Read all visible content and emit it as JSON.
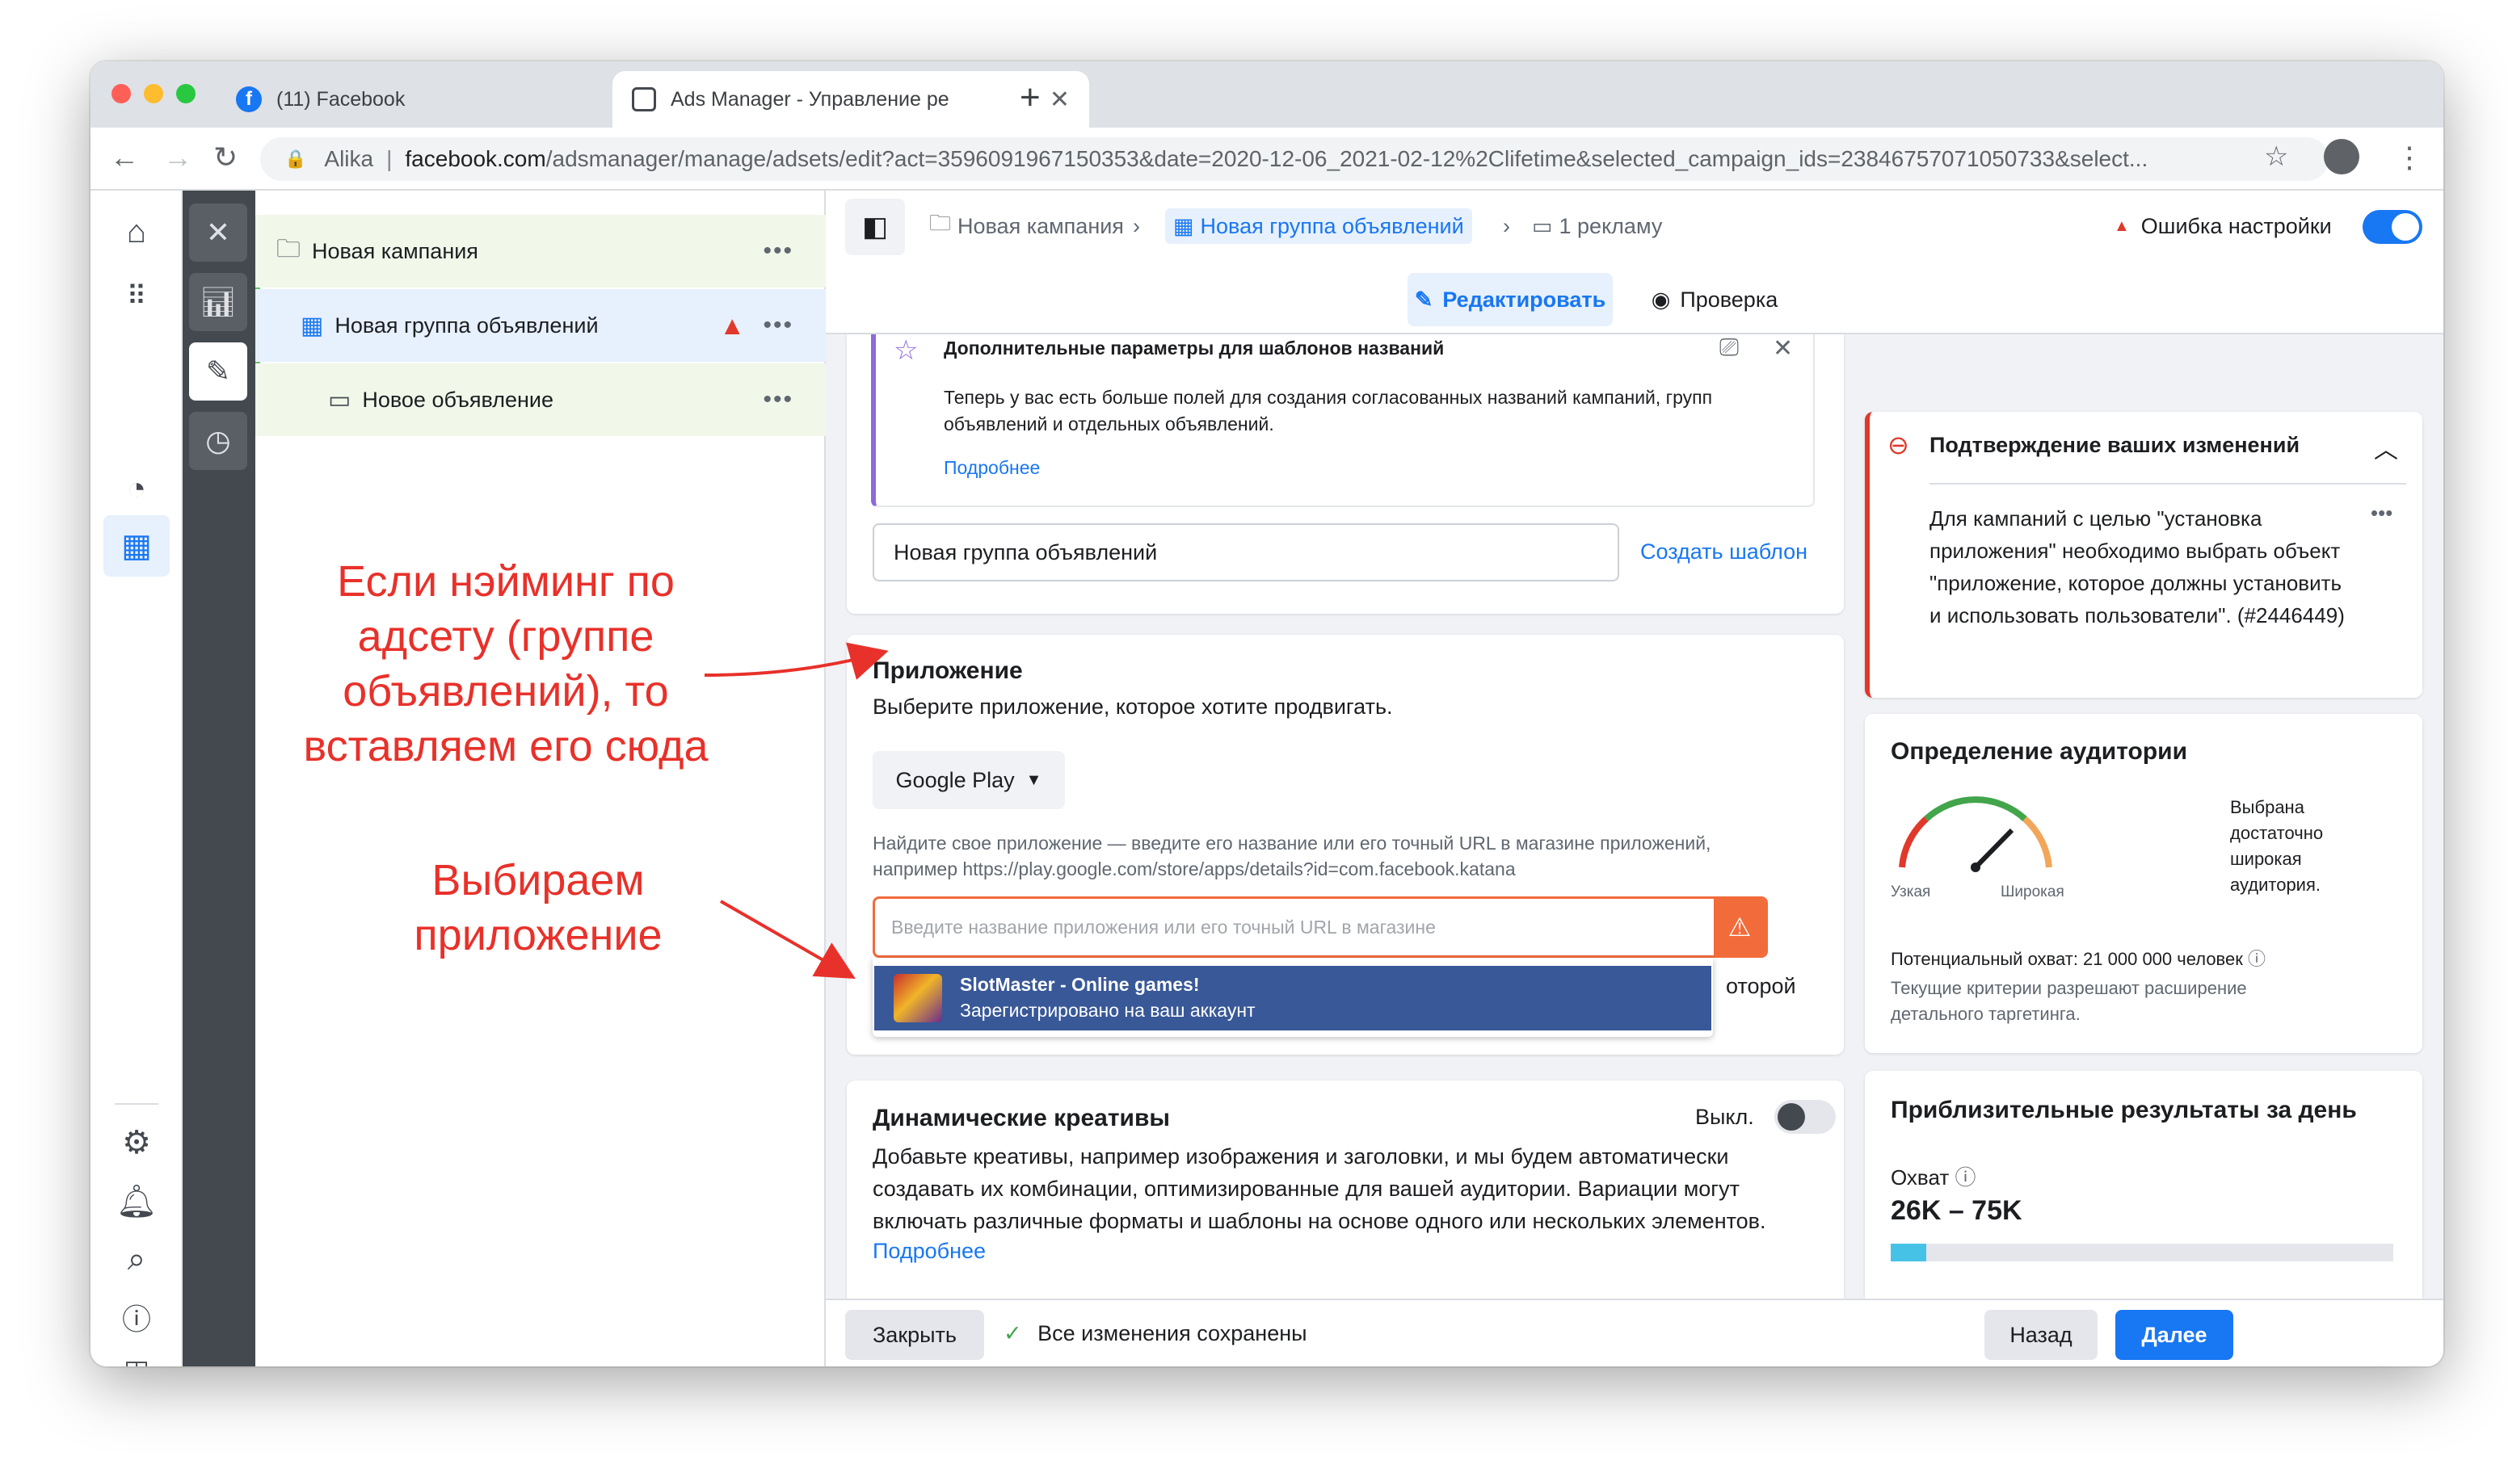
{
  "browser": {
    "tabs": [
      {
        "title": "(11) Facebook",
        "favicon": "facebook-icon"
      },
      {
        "title": "Ads Manager - Управление ре",
        "favicon": "ads-manager-icon"
      }
    ],
    "profile": "Alika",
    "url_host": "facebook.com",
    "url_path": "/adsmanager/manage/adsets/edit?act=3596091967150353&date=2020-12-06_2021-02-12%2Clifetime&selected_campaign_ids=23846757071050733&select..."
  },
  "tree": {
    "campaign": "Новая кампания",
    "adset": "Новая группа объявлений",
    "ad": "Новое объявление"
  },
  "annotations": {
    "naming": "Если нэйминг по адсету (группе объявлений), то вставляем его сюда",
    "app": "Выбираем приложение"
  },
  "breadcrumbs": {
    "campaign": "Новая кампания",
    "adset": "Новая группа объявлений",
    "ad": "1 рекламу",
    "error": "Ошибка настройки"
  },
  "modes": {
    "edit": "Редактировать",
    "review": "Проверка"
  },
  "naming_card": {
    "title": "Дополнительные параметры для шаблонов названий",
    "body": "Теперь у вас есть больше полей для создания согласованных названий кампаний, групп объявлений и отдельных объявлений.",
    "link": "Подробнее",
    "name_value": "Новая группа объявлений",
    "create_template": "Создать шаблон"
  },
  "app_card": {
    "title": "Приложение",
    "subtitle": "Выберите приложение, которое хотите продвигать.",
    "store": "Google Play",
    "hint": "Найдите свое приложение — введите его название или его точный URL в магазине приложений, например https://play.google.com/store/apps/details?id=com.facebook.katana",
    "placeholder": "Введите название приложения или его точный URL в магазине",
    "suggestion_name": "SlotMaster - Online games!",
    "suggestion_sub": "Зарегистрировано на ваш аккаунт",
    "hidden_tail": "оторой"
  },
  "dynamic_card": {
    "title": "Динамические креативы",
    "toggle_label": "Выкл.",
    "body": "Добавьте креативы, например изображения и заголовки, и мы будем автоматически создавать их комбинации, оптимизированные для вашей аудитории. Вариации могут включать различные форматы и шаблоны на основе одного или нескольких элементов.",
    "link": "Подробнее"
  },
  "confirm_card": {
    "title": "Подтверждение ваших изменений",
    "body": "Для кампаний с целью \"установка приложения\" необходимо выбрать объект \"приложение, которое должны установить и использовать пользователи\". (#2446449)"
  },
  "audience_card": {
    "title": "Определение аудитории",
    "narrow": "Узкая",
    "broad": "Широкая",
    "verdict": "Выбрана достаточно широкая аудитория.",
    "reach": "Потенциальный охват: 21 000 000 человек",
    "note": "Текущие критерии разрешают расширение детального таргетинга."
  },
  "results_card": {
    "title": "Приблизительные результаты за день",
    "reach_label": "Охват",
    "reach_value": "26K – 75K",
    "reach_fill": 0.07
  },
  "footer": {
    "close": "Закрыть",
    "saved": "Все изменения сохранены",
    "back": "Назад",
    "next": "Далее"
  },
  "colors": {
    "accent": "#1877f2",
    "error": "#e0392b",
    "annotation": "#e8312a",
    "suggestion_bg": "#385898",
    "warning": "#f26b3a"
  }
}
